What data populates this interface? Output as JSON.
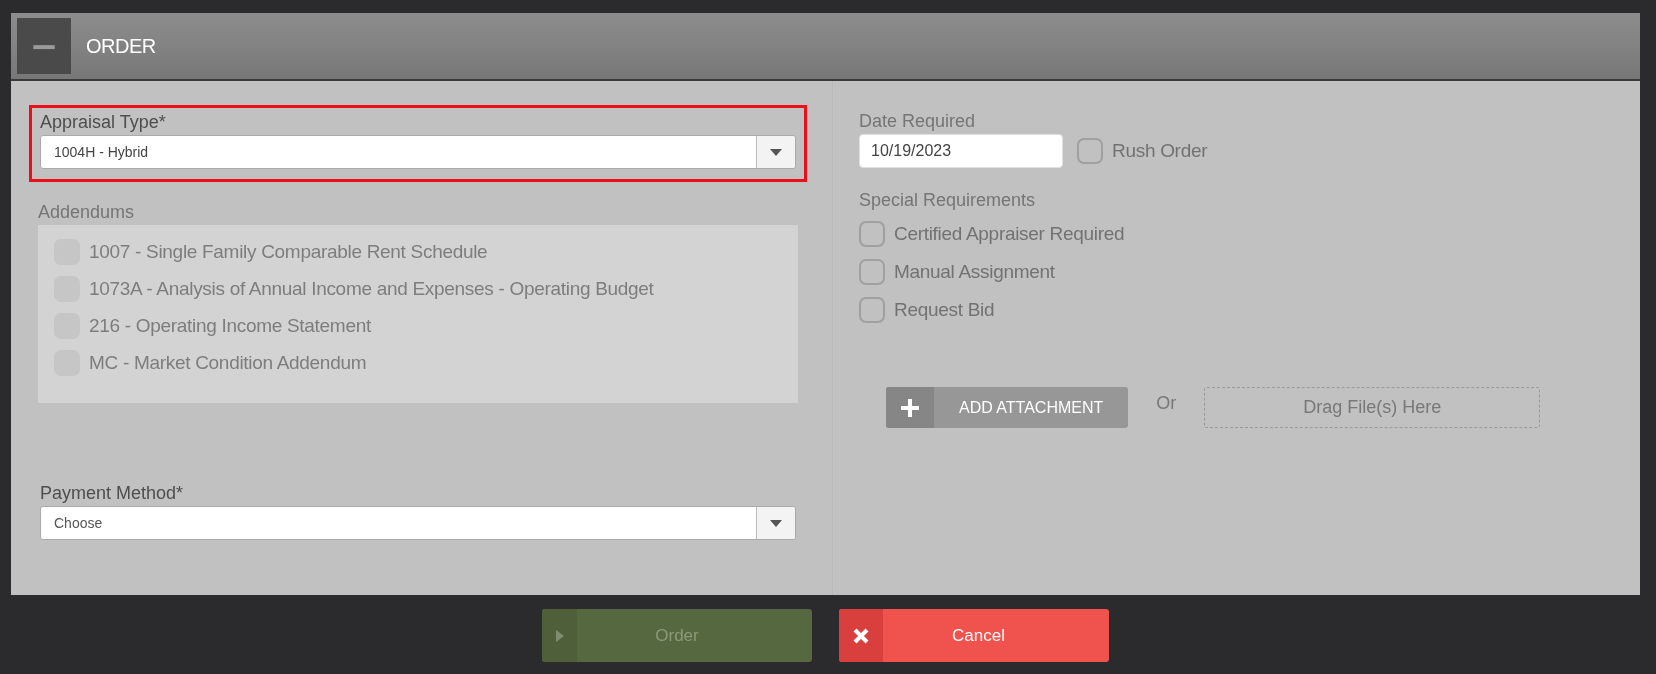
{
  "panel": {
    "title": "ORDER",
    "collapse_icon": "−"
  },
  "appraisal_type": {
    "label": "Appraisal Type*",
    "value": "1004H - Hybrid",
    "highlighted": true
  },
  "addendums": {
    "label": "Addendums",
    "items": [
      {
        "label": "1007 - Single Family Comparable Rent Schedule",
        "checked": false,
        "disabled": true
      },
      {
        "label": "1073A - Analysis of Annual Income and Expenses - Operating Budget",
        "checked": false,
        "disabled": true
      },
      {
        "label": "216 - Operating Income Statement",
        "checked": false,
        "disabled": true
      },
      {
        "label": "MC - Market Condition Addendum",
        "checked": false,
        "disabled": true
      }
    ]
  },
  "payment_method": {
    "label": "Payment Method*",
    "placeholder": "Choose"
  },
  "date_required": {
    "label": "Date Required",
    "value": "10/19/2023"
  },
  "rush_order": {
    "label": "Rush Order",
    "checked": false
  },
  "special_requirements": {
    "label": "Special Requirements",
    "items": [
      {
        "label": "Certified Appraiser Required",
        "checked": false
      },
      {
        "label": "Manual Assignment",
        "checked": false
      },
      {
        "label": "Request Bid",
        "checked": false
      }
    ]
  },
  "attachment": {
    "button": "ADD ATTACHMENT",
    "separator": "Or",
    "drop_zone": "Drag File(s) Here"
  },
  "buttons": [
    {
      "kind": "order",
      "label": "Order",
      "disabled": true
    },
    {
      "kind": "cancel",
      "label": "Cancel",
      "disabled": false
    }
  ]
}
